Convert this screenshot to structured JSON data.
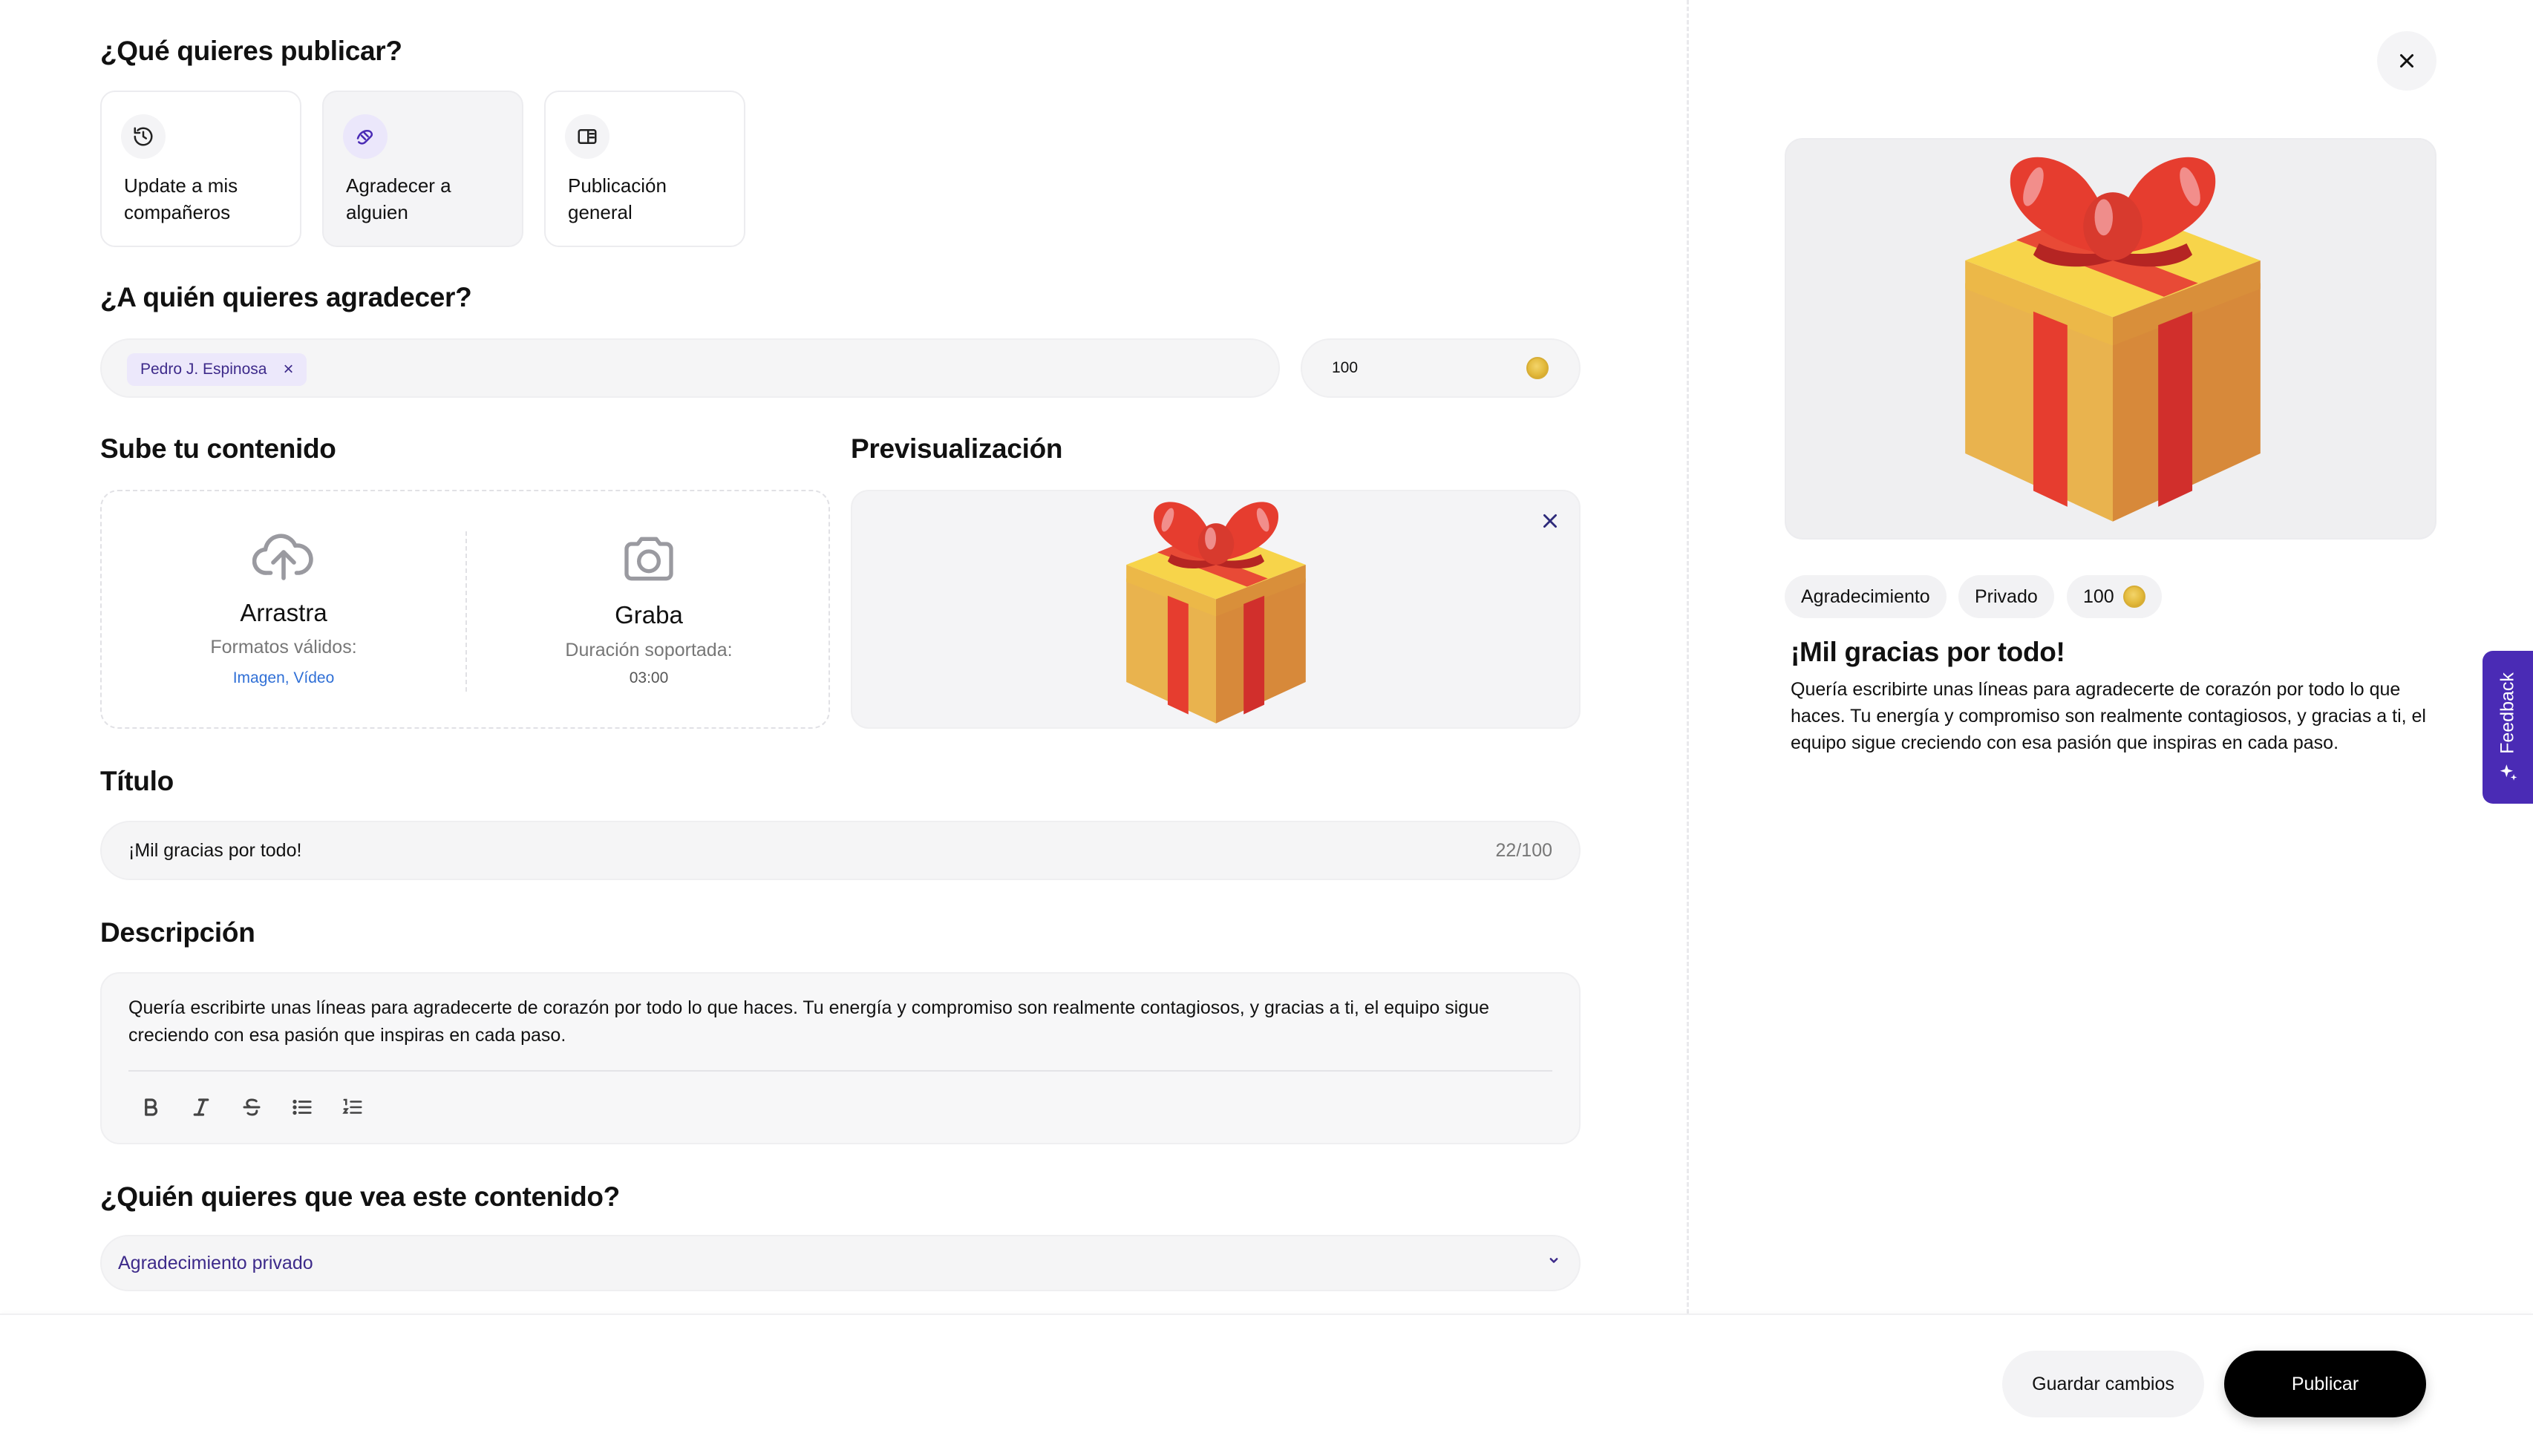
{
  "form": {
    "type_section": {
      "title": "¿Qué quieres publicar?",
      "options": [
        {
          "label": "Update a mis compañeros",
          "icon": "history-icon",
          "selected": false
        },
        {
          "label": "Agradecer a alguien",
          "icon": "handshake-icon",
          "selected": true
        },
        {
          "label": "Publicación general",
          "icon": "layout-icon",
          "selected": false
        }
      ]
    },
    "recipient_section": {
      "title": "¿A quién quieres agradecer?",
      "recipient_chip": "Pedro J. Espinosa",
      "recipient_remove": "×",
      "amount": "100",
      "amount_icon": "coin-icon"
    },
    "upload_section": {
      "title": "Sube tu contenido",
      "drag_title": "Arrastra",
      "drag_formats_label": "Formatos válidos:",
      "drag_formats_value": "Imagen, Vídeo",
      "record_title": "Graba",
      "record_duration_label": "Duración soportada:",
      "record_duration_value": "03:00"
    },
    "preview_section": {
      "title": "Previsualización"
    },
    "title_section": {
      "title": "Título",
      "value": "¡Mil gracias por todo!",
      "counter": "22/100"
    },
    "description_section": {
      "title": "Descripción",
      "value": "Quería escribirte unas líneas para agradecerte de corazón por todo lo que haces. Tu energía y compromiso son realmente contagiosos, y gracias a ti, el equipo sigue creciendo con esa pasión que inspiras en cada paso.",
      "toolbar": [
        "bold-icon",
        "italic-icon",
        "strikethrough-icon",
        "bullet-list-icon",
        "numbered-list-icon"
      ]
    },
    "visibility_section": {
      "title": "¿Quién quieres que vea este contenido?",
      "selected": "Agradecimiento privado"
    }
  },
  "footer": {
    "save_label": "Guardar cambios",
    "publish_label": "Publicar"
  },
  "side_preview": {
    "tags": [
      "Agradecimiento",
      "Privado"
    ],
    "amount": "100",
    "title": "¡Mil gracias por todo!",
    "description": "Quería escribirte unas líneas para agradecerte de corazón por todo lo que haces. Tu energía y compromiso son realmente contagiosos, y gracias a ti, el equipo sigue creciendo con esa pasión que inspiras en cada paso."
  },
  "feedback_tab": {
    "label": "Feedback"
  },
  "colors": {
    "accent": "#4a2bb5",
    "link": "#2f6fd6",
    "field_bg": "#f5f5f6",
    "primary_button": "#000000"
  }
}
